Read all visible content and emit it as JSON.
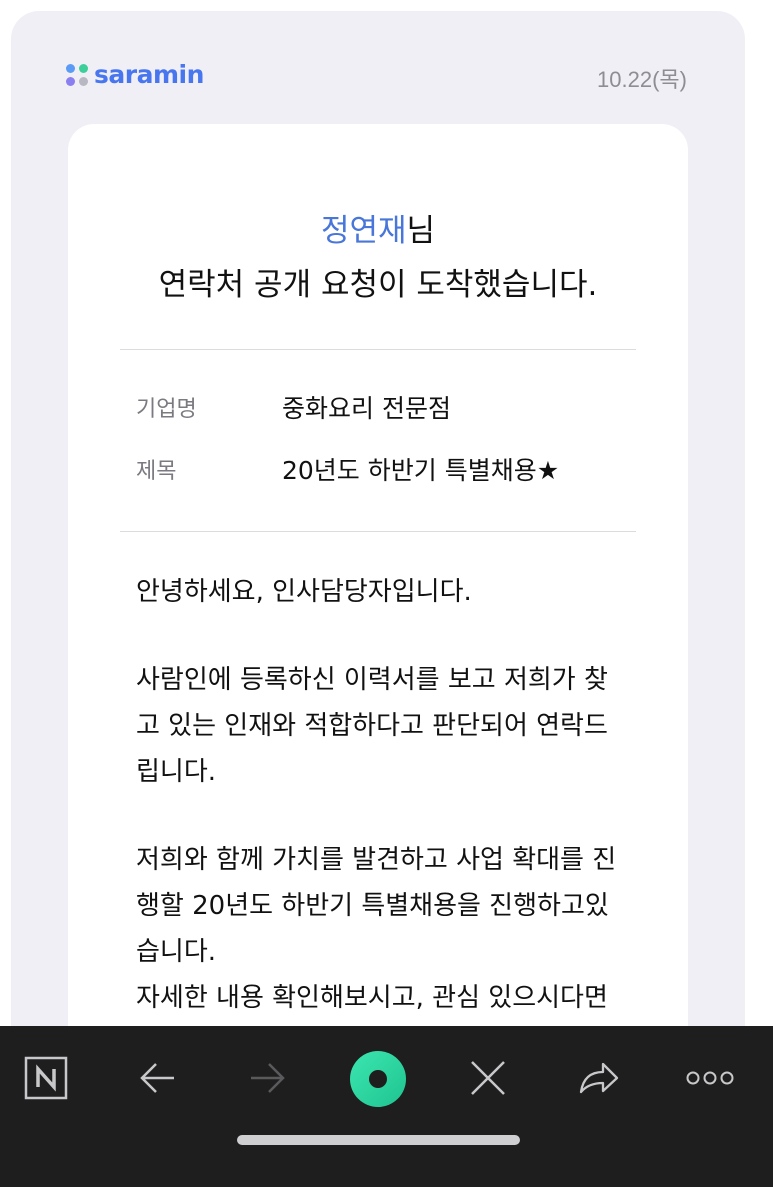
{
  "header": {
    "logo_text": "saramin",
    "logo_dot_colors": [
      "#5b9bf5",
      "#3ccf9a",
      "#8a7ff0",
      "#b8b8c2"
    ],
    "date": "10.22(목)"
  },
  "greeting": {
    "name": "정연재",
    "suffix": "님",
    "message": "연락처 공개 요청이 도착했습니다."
  },
  "info": {
    "company_label": "기업명",
    "company_value": "중화요리 전문점",
    "title_label": "제목",
    "title_value": "20년도 하반기 특별채용★"
  },
  "body": {
    "p1": "안녕하세요, 인사담당자입니다.",
    "p2": "사람인에 등록하신 이력서를 보고 저희가 찾\n고 있는 인재와 적합하다고 판단되어 연락드\n립니다.",
    "p3": "저희와 함께 가치를 발견하고 사업 확대를 진\n행할 20년도 하반기 특별채용을 진행하고있\n습니다.",
    "p4": "자세한 내용 확인해보시고, 관심 있으시다면"
  },
  "toolbar": {
    "items": [
      {
        "name": "naver-n-icon",
        "label": "N"
      },
      {
        "name": "back-arrow-icon"
      },
      {
        "name": "forward-arrow-icon"
      },
      {
        "name": "green-dot-icon"
      },
      {
        "name": "close-icon"
      },
      {
        "name": "share-icon"
      },
      {
        "name": "more-icon"
      }
    ],
    "colors": {
      "background": "#1e1e1f",
      "icon": "#c8c8ca",
      "icon_disabled": "#5a5a5c",
      "accent": "#2bd6a4"
    }
  }
}
